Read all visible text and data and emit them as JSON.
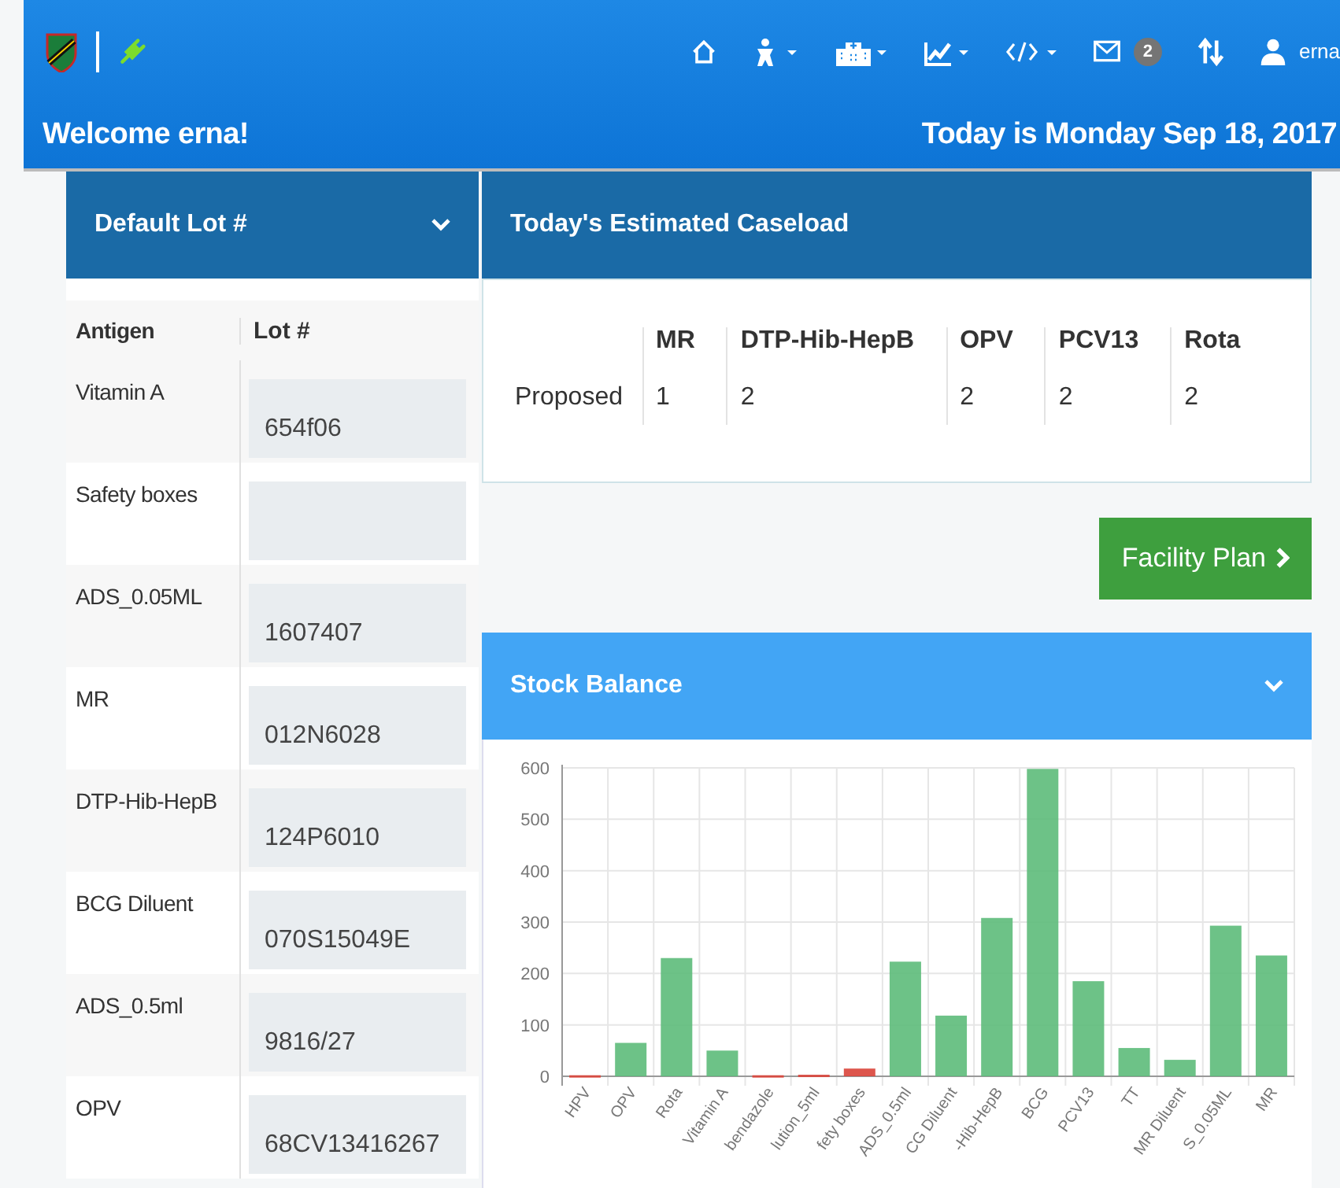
{
  "navbar": {
    "badge": "2",
    "user": "erna"
  },
  "welcome": {
    "greeting": "Welcome erna!",
    "date": "Today is Monday Sep 18, 2017"
  },
  "lot_panel": {
    "title": "Default Lot #",
    "expanded": true,
    "columns": [
      "Antigen",
      "Lot #"
    ],
    "rows": [
      {
        "antigen": "Vitamin A",
        "lot": "654f06"
      },
      {
        "antigen": "Safety boxes"
      },
      {
        "antigen": "ADS_0.05ML",
        "lot": "1607407"
      },
      {
        "antigen": "MR",
        "lot": "012N6028"
      },
      {
        "antigen": "DTP-Hib-HepB",
        "lot": "124P6010"
      },
      {
        "antigen": "BCG Diluent",
        "lot": "070S15049E"
      },
      {
        "antigen": "ADS_0.5ml",
        "lot": "9816/27"
      },
      {
        "antigen": "OPV",
        "lot": "68CV13416267"
      }
    ]
  },
  "caseload": {
    "title": "Today's Estimated Caseload",
    "columns": [
      "MR",
      "DTP-Hib-HepB",
      "OPV",
      "PCV13",
      "Rota"
    ],
    "rows": [
      {
        "label": "Proposed",
        "values": [
          "1",
          "2",
          "2",
          "2",
          "2"
        ]
      }
    ]
  },
  "facility_button": "Facility Plan",
  "stock_balance": {
    "title": "Stock Balance",
    "expanded": true,
    "chart_data": {
      "type": "bar",
      "stacked": true,
      "grid": true,
      "categories": [
        "HPV",
        "OPV",
        "Rota",
        "Vitamin A",
        "bendazole",
        "lution_5ml",
        "fety boxes",
        "ADS_0.5ml",
        "CG Diluent",
        "-Hib-HepB",
        "BCG",
        "PCV13",
        "TT",
        "MR Diluent",
        "S_0.05ML",
        "MR"
      ],
      "series": [
        {
          "color": "#5dbb7a",
          "values": [
            null,
            65,
            230,
            50,
            null,
            null,
            null,
            223,
            118,
            308,
            598,
            185,
            55,
            32,
            293,
            235
          ]
        },
        {
          "color": "#d9443a",
          "values": [
            2,
            null,
            null,
            null,
            2,
            3,
            15,
            null,
            null,
            null,
            null,
            null,
            null,
            null,
            null,
            null
          ]
        }
      ],
      "ylim": [
        0,
        600
      ],
      "yticks": [
        0,
        100,
        200,
        300,
        400,
        500,
        600
      ]
    }
  }
}
